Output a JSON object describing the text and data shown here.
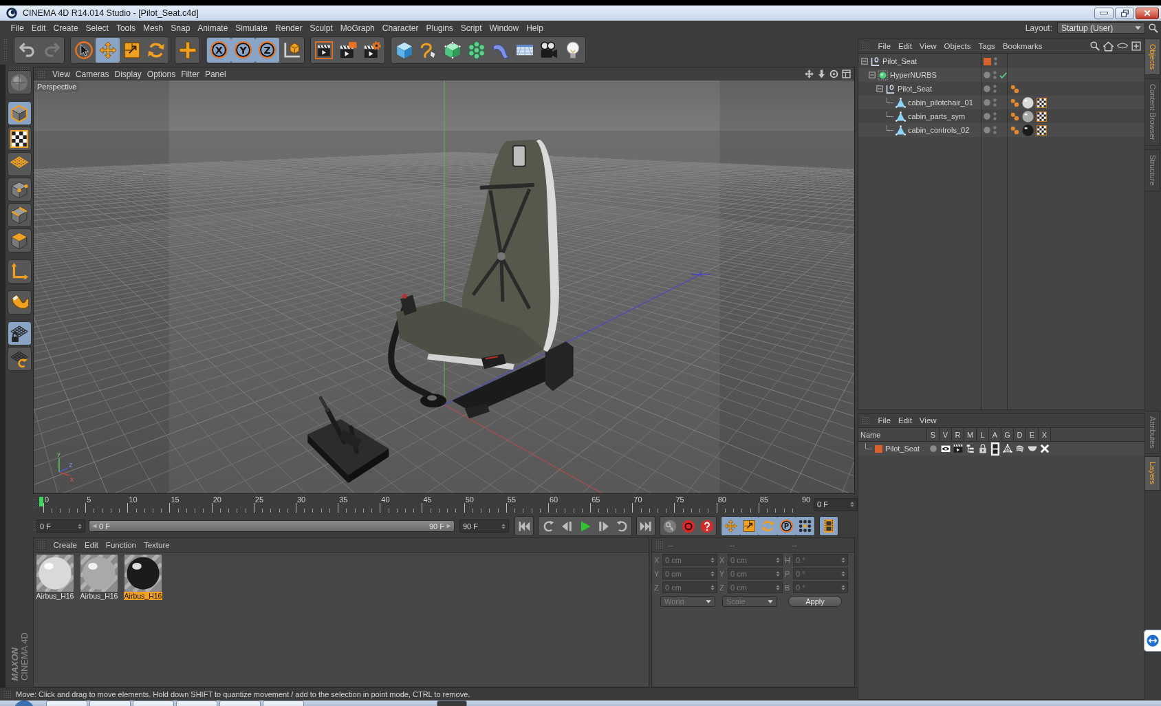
{
  "window": {
    "title": "CINEMA 4D R14.014 Studio - [Pilot_Seat.c4d]"
  },
  "menu_bar": [
    "File",
    "Edit",
    "Create",
    "Select",
    "Tools",
    "Mesh",
    "Snap",
    "Animate",
    "Simulate",
    "Render",
    "Sculpt",
    "MoGraph",
    "Character",
    "Plugins",
    "Script",
    "Window",
    "Help"
  ],
  "layout": {
    "label": "Layout:",
    "value": "Startup (User)"
  },
  "toolbar": {
    "history": [
      {
        "kind": "undo",
        "disabled": false
      },
      {
        "kind": "redo",
        "disabled": true
      }
    ],
    "tools": [
      [
        {
          "kind": "select",
          "active": false
        },
        {
          "kind": "move",
          "active": true
        },
        {
          "kind": "scale",
          "active": false
        },
        {
          "kind": "rotate",
          "active": false
        }
      ],
      [
        {
          "kind": "live-tool",
          "active": false
        }
      ],
      [
        {
          "kind": "axis-lock",
          "label": "X",
          "active": true
        },
        {
          "kind": "axis-lock",
          "label": "Y",
          "active": true
        },
        {
          "kind": "axis-lock",
          "label": "Z",
          "active": true
        },
        {
          "kind": "coordinate-system",
          "active": false
        }
      ],
      [
        {
          "kind": "render-view",
          "active": false
        },
        {
          "kind": "render-picture-viewer",
          "active": false
        },
        {
          "kind": "render-settings",
          "active": false
        }
      ],
      [
        {
          "kind": "cube",
          "active": false
        },
        {
          "kind": "pen",
          "active": false
        },
        {
          "kind": "subdivision",
          "active": false
        },
        {
          "kind": "array",
          "active": false
        },
        {
          "kind": "bend",
          "active": false
        },
        {
          "kind": "floor",
          "active": false
        },
        {
          "kind": "camera",
          "active": false
        },
        {
          "kind": "light",
          "active": false
        }
      ]
    ]
  },
  "left_palette": {
    "groups": [
      [
        {
          "kind": "make-editable",
          "active": false
        }
      ],
      [
        {
          "kind": "model",
          "active": true
        },
        {
          "kind": "texture",
          "active": false
        },
        {
          "kind": "workplane",
          "active": false
        },
        {
          "kind": "points",
          "active": false
        },
        {
          "kind": "edges",
          "active": false
        },
        {
          "kind": "polygons",
          "active": false
        }
      ],
      [
        {
          "kind": "axis",
          "active": false
        }
      ],
      [
        {
          "kind": "tweak",
          "active": false
        }
      ],
      [
        {
          "kind": "locked-workplane",
          "active": true
        },
        {
          "kind": "planar-workplane",
          "active": false
        }
      ]
    ],
    "logo": [
      "MAXON",
      "CINEMA 4D"
    ]
  },
  "viewport": {
    "menu": [
      "View",
      "Cameras",
      "Display",
      "Options",
      "Filter",
      "Panel"
    ],
    "camera_label": "Perspective",
    "axis_gizmo": [
      "Y",
      "Z",
      "X"
    ]
  },
  "timeline": {
    "labels": [
      "0",
      "5",
      "10",
      "15",
      "20",
      "25",
      "30",
      "35",
      "40",
      "45",
      "50",
      "55",
      "60",
      "65",
      "70",
      "75",
      "80",
      "85",
      "90"
    ],
    "playhead": {
      "level": 0
    },
    "frame_field": "0 F"
  },
  "transport": {
    "start_field": "0 F",
    "range": {
      "start": "0 F",
      "end": "90 F",
      "level": 1
    },
    "end_field": "90 F",
    "playback": [
      [
        {
          "kind": "go-to-start"
        }
      ],
      [
        {
          "kind": "previous-key"
        },
        {
          "kind": "previous-frame"
        },
        {
          "kind": "play"
        },
        {
          "kind": "next-frame"
        },
        {
          "kind": "next-key"
        }
      ],
      [
        {
          "kind": "go-to-end"
        }
      ]
    ],
    "record": [
      {
        "kind": "autokey"
      },
      {
        "kind": "record"
      },
      {
        "kind": "keyframe-selection"
      }
    ],
    "key_tracks": [
      {
        "kind": "position",
        "active": true
      },
      {
        "kind": "scale",
        "active": true
      },
      {
        "kind": "rotation",
        "active": true
      },
      {
        "kind": "parameter",
        "label": "P",
        "active": true
      },
      {
        "kind": "point-level",
        "active": true
      }
    ],
    "timeline_button": {
      "active": true
    }
  },
  "material_manager": {
    "menu": [
      "Create",
      "Edit",
      "Function",
      "Texture"
    ],
    "materials": [
      {
        "name": "Airbus_H16",
        "color": "#d9d9d9",
        "selected": false
      },
      {
        "name": "Airbus_H16",
        "color": "#a9a9a9",
        "selected": false
      },
      {
        "name": "Airbus_H16",
        "color": "#1b1b1b",
        "selected": true
      }
    ]
  },
  "coordinates": {
    "headers": [
      "--",
      "--",
      "--"
    ],
    "disabled": true,
    "rows": [
      [
        {
          "label": "X",
          "value": "0 cm"
        },
        {
          "label": "X",
          "value": "0 cm"
        },
        {
          "label": "H",
          "value": "0 °"
        }
      ],
      [
        {
          "label": "Y",
          "value": "0 cm"
        },
        {
          "label": "Y",
          "value": "0 cm"
        },
        {
          "label": "P",
          "value": "0 °"
        }
      ],
      [
        {
          "label": "Z",
          "value": "0 cm"
        },
        {
          "label": "Z",
          "value": "0 cm"
        },
        {
          "label": "B",
          "value": "0 °"
        }
      ]
    ],
    "dropdowns": [
      "World",
      "Scale"
    ],
    "apply": "Apply"
  },
  "status_bar": "Move: Click and drag to move elements. Hold down SHIFT to quantize movement / add to the selection in point mode, CTRL to remove.",
  "object_manager": {
    "menu": [
      "File",
      "Edit",
      "View",
      "Objects",
      "Tags",
      "Bookmarks"
    ],
    "objects": [
      {
        "name": "Pilot_Seat",
        "kind": "null",
        "expanded": true,
        "selected": false,
        "color": "#d9622b",
        "children": [
          {
            "name": "HyperNURBS",
            "kind": "subdivision",
            "expanded": true,
            "selected": false,
            "enabled": true,
            "children": [
              {
                "name": "Pilot_Seat",
                "kind": "null",
                "expanded": true,
                "selected": false,
                "tags": [
                  {
                    "kind": "phong"
                  }
                ],
                "children": [
                  {
                    "name": "cabin_pilotchair_01",
                    "kind": "polygon",
                    "selected": false,
                    "tags": [
                      {
                        "kind": "phong"
                      },
                      {
                        "kind": "material",
                        "color": "#d9d9d9"
                      },
                      {
                        "kind": "uvw"
                      }
                    ]
                  },
                  {
                    "name": "cabin_parts_sym",
                    "kind": "polygon",
                    "selected": false,
                    "tags": [
                      {
                        "kind": "phong"
                      },
                      {
                        "kind": "material",
                        "color": "#a9a9a9"
                      },
                      {
                        "kind": "uvw"
                      }
                    ]
                  },
                  {
                    "name": "cabin_controls_02",
                    "kind": "polygon",
                    "selected": false,
                    "tags": [
                      {
                        "kind": "phong"
                      },
                      {
                        "kind": "material",
                        "color": "#1b1b1b"
                      },
                      {
                        "kind": "uvw"
                      }
                    ]
                  }
                ]
              }
            ]
          }
        ]
      }
    ]
  },
  "layer_manager": {
    "menu": [
      "File",
      "Edit",
      "View"
    ],
    "columns": [
      "Name",
      "S",
      "V",
      "R",
      "M",
      "L",
      "A",
      "G",
      "D",
      "E",
      "X"
    ],
    "layers": [
      {
        "name": "Pilot_Seat",
        "color": "#d9622b",
        "selected": false,
        "flags": [
          {
            "kind": "solo",
            "on": false
          },
          {
            "kind": "visible",
            "on": true
          },
          {
            "kind": "render",
            "on": true
          },
          {
            "kind": "manager",
            "on": true
          },
          {
            "kind": "locked",
            "on": true
          },
          {
            "kind": "animation",
            "on": true
          },
          {
            "kind": "generators",
            "on": true
          },
          {
            "kind": "deformers",
            "on": true
          },
          {
            "kind": "expressions",
            "on": true
          },
          {
            "kind": "xref",
            "on": true
          }
        ]
      }
    ]
  },
  "side_tabs": {
    "upper": [
      {
        "label": "Objects",
        "selected": true
      },
      {
        "label": "Content Browser",
        "selected": false
      },
      {
        "label": "Structure",
        "selected": false
      }
    ],
    "lower": [
      {
        "label": "Attributes",
        "selected": false
      },
      {
        "label": "Layers",
        "selected": true
      }
    ]
  }
}
